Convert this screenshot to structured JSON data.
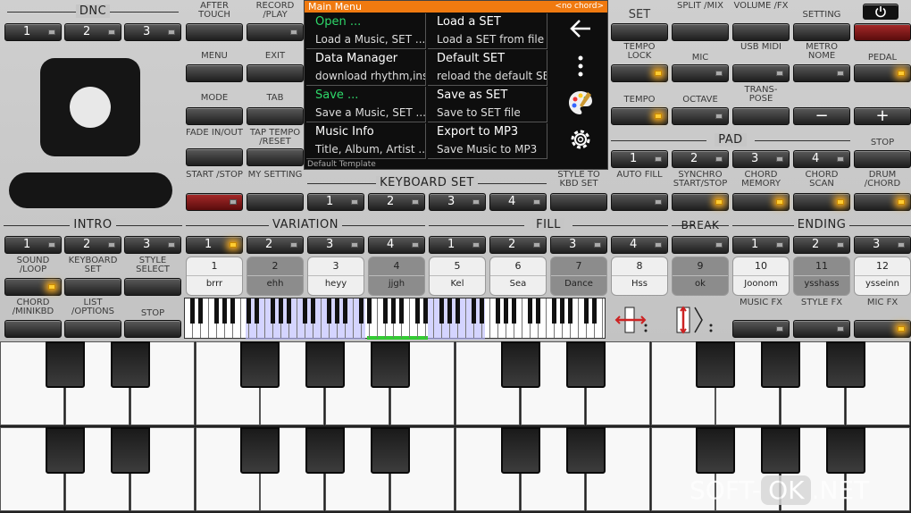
{
  "sections": {
    "dnc": "DNC",
    "keyboard_set": "KEYBOARD SET",
    "intro": "INTRO",
    "variation": "VARIATION",
    "fill": "FILL",
    "break": "BREAK",
    "ending": "ENDING",
    "pad": "PAD"
  },
  "left_labels": {
    "after_touch": "AFTER TOUCH",
    "record_play": "RECORD /PLAY",
    "menu": "MENU",
    "exit": "EXIT",
    "mode": "MODE",
    "tab": "TAB",
    "fade_inout": "FADE IN/OUT",
    "tap_tempo": "TAP TEMPO /RESET",
    "start_stop": "START /STOP",
    "my_setting": "MY SETTING",
    "style_to_kbd": "STYLE TO KBD SET",
    "sound_loop": "SOUND /LOOP",
    "keyboard_set2": "KEYBOARD SET",
    "style_select": "STYLE SELECT",
    "chord_minikbd": "CHORD /MINIKBD",
    "list_options": "LIST /OPTIONS",
    "stop2": "STOP"
  },
  "right_labels": {
    "set": "SET",
    "split_mix": "SPLIT /MIX",
    "volume_fx": "VOLUME /FX",
    "setting": "SETTING",
    "tempo_lock": "TEMPO LOCK",
    "mic": "MIC",
    "usb_midi": "USB MIDI",
    "metronome": "METRO NOME",
    "pedal": "PEDAL",
    "tempo": "TEMPO",
    "octave": "OCTAVE",
    "transpose": "TRANS- POSE",
    "minus": "−",
    "plus": "+",
    "stop": "STOP",
    "auto_fill": "AUTO FILL",
    "synchro": "SYNCHRO START/STOP",
    "chord_memory": "CHORD MEMORY",
    "chord_scan": "CHORD SCAN",
    "drum_chord": "DRUM /CHORD",
    "music_fx": "MUSIC FX",
    "style_fx": "STYLE FX",
    "mic_fx": "MIC FX"
  },
  "numbers": [
    "1",
    "2",
    "3",
    "4"
  ],
  "power_icon": "power-icon",
  "menu": {
    "title": "Main Menu",
    "chord": "<no chord>",
    "footer": "Default Template",
    "items": [
      {
        "a": "Open ...",
        "b": "Load a Music, SET ..."
      },
      {
        "a": "Load a SET",
        "b": "Load a SET from file"
      },
      {
        "a": "Data Manager",
        "b": "download rhythm,inst.."
      },
      {
        "a": "Default SET",
        "b": "reload the default SET"
      },
      {
        "a": "Save ...",
        "b": "Save a Music, SET ..."
      },
      {
        "a": "Save as SET",
        "b": "Save to SET file"
      },
      {
        "a": "Music Info",
        "b": "Title, Album, Artist ..."
      },
      {
        "a": "Export to MP3",
        "b": "Save Music to MP3"
      }
    ]
  },
  "pads": [
    {
      "n": "1",
      "t": "brrr"
    },
    {
      "n": "2",
      "t": "ehh"
    },
    {
      "n": "3",
      "t": "heyy"
    },
    {
      "n": "4",
      "t": "jjgh"
    },
    {
      "n": "5",
      "t": "Kel"
    },
    {
      "n": "6",
      "t": "Sea"
    },
    {
      "n": "7",
      "t": "Dance"
    },
    {
      "n": "8",
      "t": "Hss"
    },
    {
      "n": "9",
      "t": "ok"
    },
    {
      "n": "10",
      "t": "Joonom"
    },
    {
      "n": "11",
      "t": "ysshass"
    },
    {
      "n": "12",
      "t": "ysseinn"
    }
  ],
  "watermark": {
    "a": "SOFT-",
    "b": "OK",
    ".c": ".NET",
    "c": ".NET"
  }
}
